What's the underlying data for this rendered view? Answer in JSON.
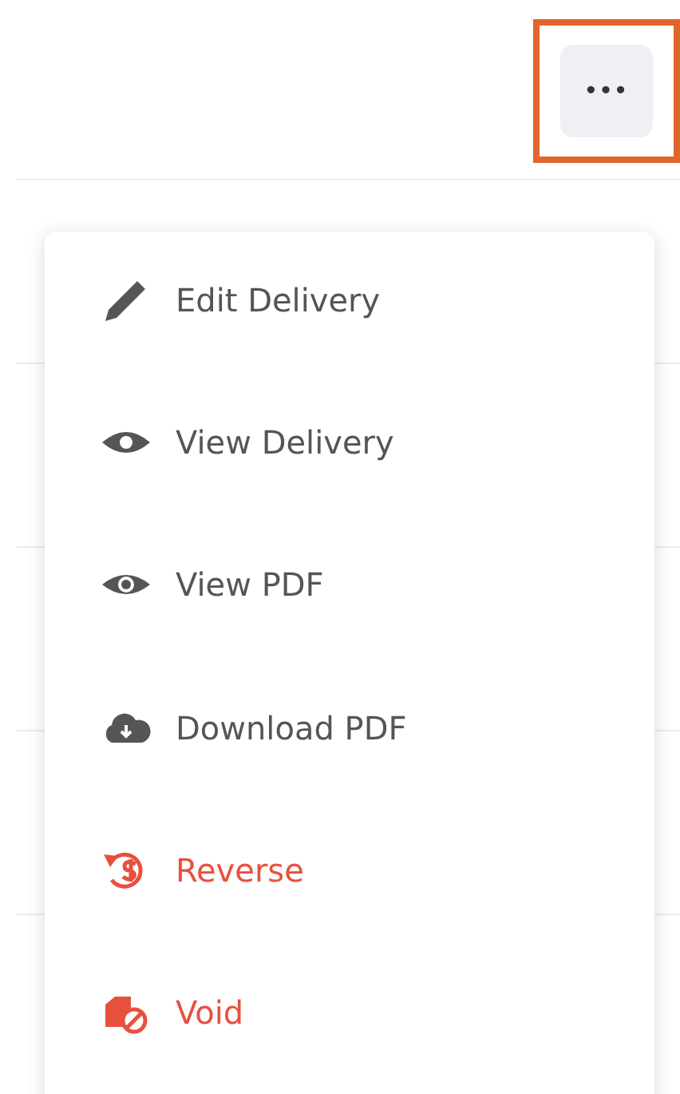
{
  "more_button": {
    "label": "•••",
    "highlighted": true
  },
  "menu": {
    "items": [
      {
        "kind": "edit",
        "label": "Edit Delivery",
        "color": "#555555"
      },
      {
        "kind": "view",
        "label": "View Delivery",
        "color": "#555555"
      },
      {
        "kind": "preview",
        "label": "View PDF",
        "color": "#555555"
      },
      {
        "kind": "download",
        "label": "Download PDF",
        "color": "#555555"
      },
      {
        "kind": "reverse",
        "label": "Reverse",
        "color": "#e8503e"
      },
      {
        "kind": "void",
        "label": "Void",
        "color": "#e8503e"
      }
    ]
  }
}
